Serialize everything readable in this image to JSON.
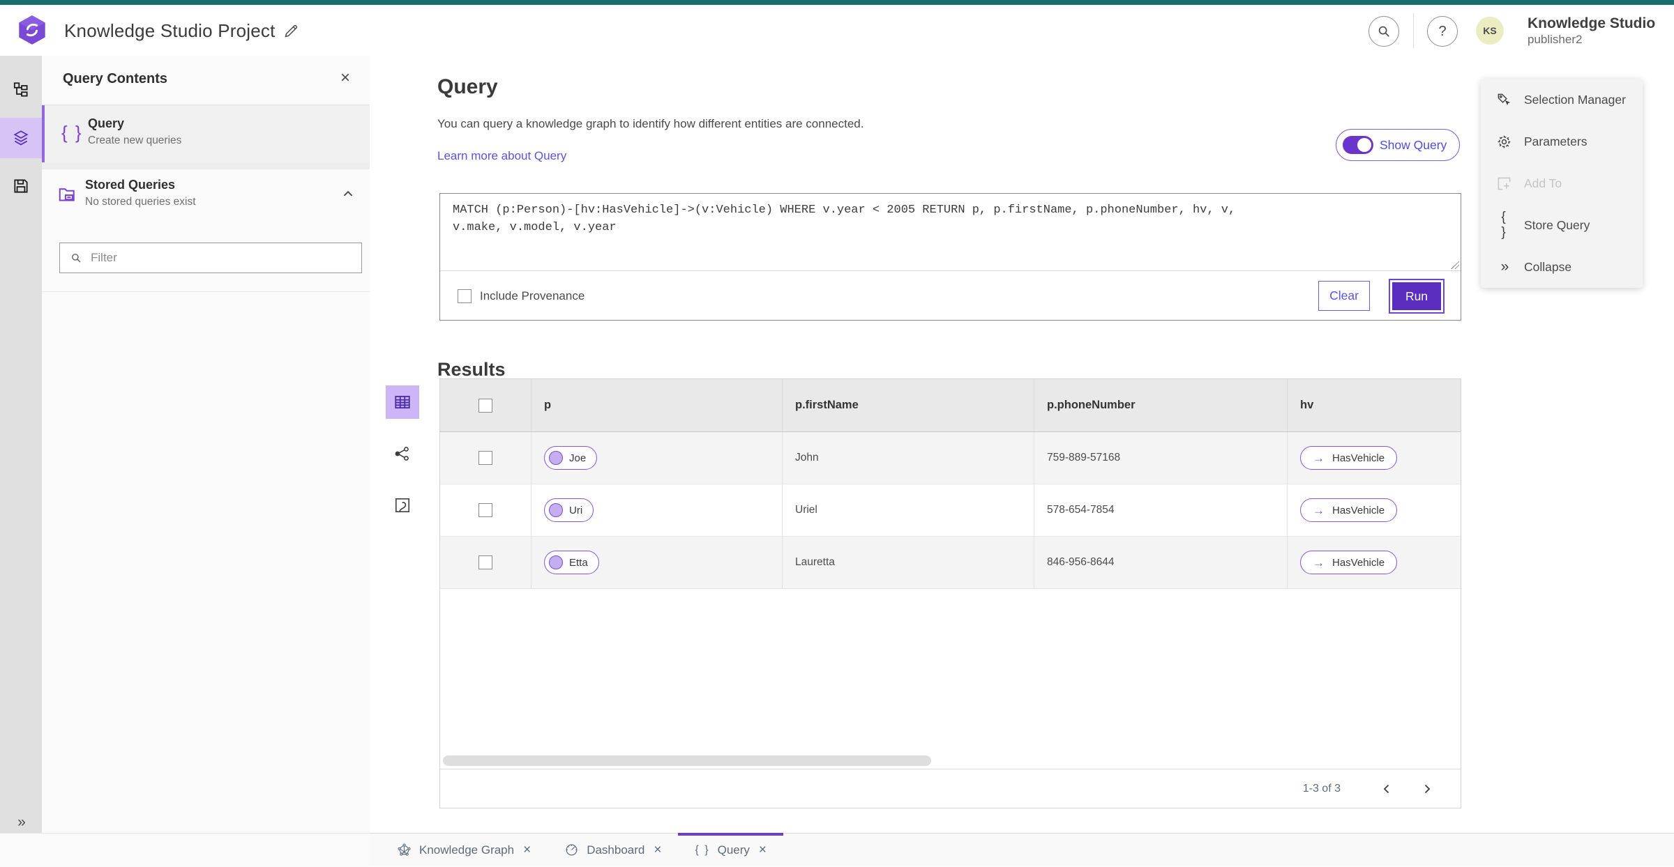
{
  "header": {
    "title": "Knowledge Studio Project",
    "search_tooltip": "Search",
    "help_glyph": "?",
    "avatar_initials": "KS",
    "product_name": "Knowledge Studio",
    "user_name": "publisher2"
  },
  "sidebar": {
    "title": "Query Contents",
    "close_glyph": "×",
    "query_item": {
      "icon_glyph": "{ }",
      "title": "Query",
      "subtitle": "Create new queries"
    },
    "stored_queries": {
      "title": "Stored Queries",
      "subtitle": "No stored queries exist"
    },
    "filter_placeholder": "Filter"
  },
  "query_panel": {
    "heading": "Query",
    "description": "You can query a knowledge graph to identify how different entities are connected.",
    "learn_more_label": "Learn more about Query",
    "show_query_label": "Show Query",
    "query_text": "MATCH (p:Person)-[hv:HasVehicle]->(v:Vehicle) WHERE v.year < 2005 RETURN p, p.firstName, p.phoneNumber, hv, v,\nv.make, v.model, v.year",
    "include_provenance_label": "Include Provenance",
    "clear_label": "Clear",
    "run_label": "Run"
  },
  "results": {
    "heading": "Results",
    "columns": [
      "p",
      "p.firstName",
      "p.phoneNumber",
      "hv"
    ],
    "rows": [
      {
        "p": "Joe",
        "firstName": "John",
        "phone": "759-889-57168",
        "hv": "HasVehicle",
        "edge_arrow": "→"
      },
      {
        "p": "Uri",
        "firstName": "Uriel",
        "phone": "578-654-7854",
        "hv": "HasVehicle",
        "edge_arrow": "→"
      },
      {
        "p": "Etta",
        "firstName": "Lauretta",
        "phone": "846-956-8644",
        "hv": "HasVehicle",
        "edge_arrow": "→"
      }
    ],
    "pagination_label": "1-3 of 3"
  },
  "side_tools": {
    "selection_manager": "Selection Manager",
    "parameters": "Parameters",
    "add_to": "Add To",
    "store_query": "Store Query",
    "collapse": "Collapse",
    "store_query_glyph": "{ }",
    "collapse_glyph": "»"
  },
  "bottom_tabs": {
    "tab1": "Knowledge Graph",
    "tab2": "Dashboard",
    "tab3": "Query",
    "close_glyph": "×",
    "query_icon_glyph": "{ }"
  },
  "rail": {
    "expand_glyph": "»"
  },
  "colors": {
    "teal_top_bar": "#1b6d6d",
    "accent_purple": "#6a3dc8",
    "run_button_purple": "#5a2dbe",
    "link_purple": "#5b52dd",
    "rail_selected_bg": "#d7c3f6",
    "pill_border": "#8158d8",
    "row_zebra": "#f4f4f4"
  }
}
